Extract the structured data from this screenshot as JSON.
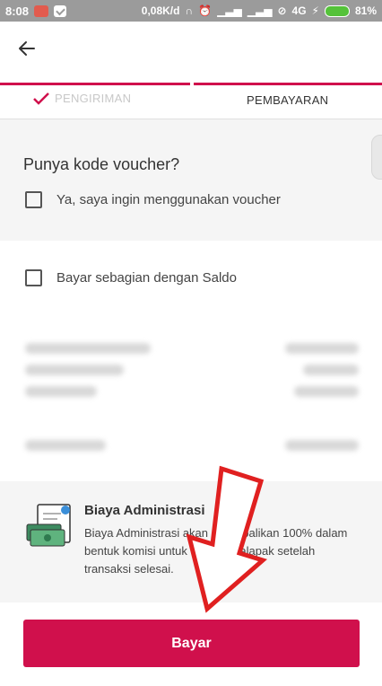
{
  "status_bar": {
    "time": "8:08",
    "network_speed": "0,08K/d",
    "network_type": "4G",
    "battery": "81%",
    "icons": [
      "notification-badge-icon",
      "check-badge-icon",
      "headset-icon",
      "alarm-icon",
      "signal-icon",
      "signal-icon",
      "signal-off-icon",
      "charging-icon",
      "battery-icon"
    ]
  },
  "app_bar": {
    "back_icon": "arrow-left-icon"
  },
  "stepper": {
    "step1_label": "PENGIRIMAN",
    "step1_icon": "checkmark-icon",
    "step2_label": "PEMBAYARAN",
    "accent_color": "#d0104c"
  },
  "voucher": {
    "title": "Punya kode voucher?",
    "checkbox_label": "Ya, saya ingin menggunakan voucher"
  },
  "saldo": {
    "checkbox_label": "Bayar sebagian dengan Saldo"
  },
  "admin_fee": {
    "icon": "money-document-icon",
    "title": "Biaya Administrasi",
    "description": "Biaya Administrasi akan dikembalikan 100% dalam bentuk komisi untuk Mitra Bukalapak setelah transaksi selesai."
  },
  "footer": {
    "pay_label": "Bayar"
  },
  "overlay": {
    "icon": "big-arrow-down-icon",
    "color": "#e02020"
  }
}
